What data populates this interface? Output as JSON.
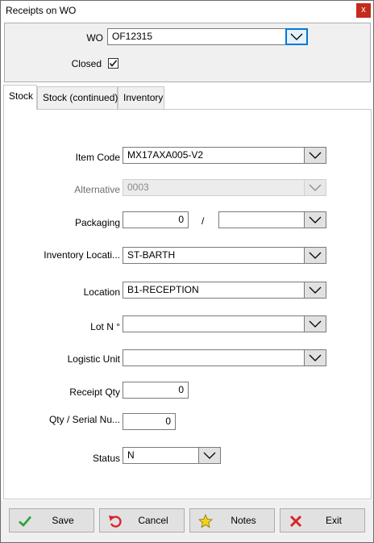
{
  "window": {
    "title": "Receipts on WO",
    "close_label": "x"
  },
  "header": {
    "wo_label": "WO",
    "wo_value": "OF12315",
    "closed_label": "Closed",
    "closed_checked": true
  },
  "tabs": [
    {
      "label": "Stock",
      "active": true
    },
    {
      "label": "Stock (continued)",
      "active": false
    },
    {
      "label": "Inventory",
      "active": false
    }
  ],
  "form": {
    "item_code": {
      "label": "Item Code",
      "value": "MX17AXA005-V2"
    },
    "alternative": {
      "label": "Alternative",
      "value": "0003",
      "disabled": true
    },
    "packaging": {
      "label": "Packaging",
      "value": "0",
      "separator": "/",
      "unit_value": ""
    },
    "inventory_location": {
      "label": "Inventory Locati...",
      "value": "ST-BARTH"
    },
    "location": {
      "label": "Location",
      "value": "B1-RECEPTION"
    },
    "lot": {
      "label": "Lot N °",
      "value": ""
    },
    "logistic_unit": {
      "label": "Logistic Unit",
      "value": ""
    },
    "receipt_qty": {
      "label": "Receipt Qty",
      "value": "0"
    },
    "qty_serial": {
      "label": "Qty / Serial Nu...",
      "value": "0"
    },
    "status": {
      "label": "Status",
      "value": "N"
    }
  },
  "buttons": {
    "save": {
      "label": "Save",
      "icon": "check-icon",
      "color": "#2e9e3a"
    },
    "cancel": {
      "label": "Cancel",
      "icon": "undo-icon",
      "color": "#d9242b"
    },
    "notes": {
      "label": "Notes",
      "icon": "star-icon",
      "color": "#f2d21b"
    },
    "exit": {
      "label": "Exit",
      "icon": "x-icon",
      "color": "#d9242b"
    }
  }
}
